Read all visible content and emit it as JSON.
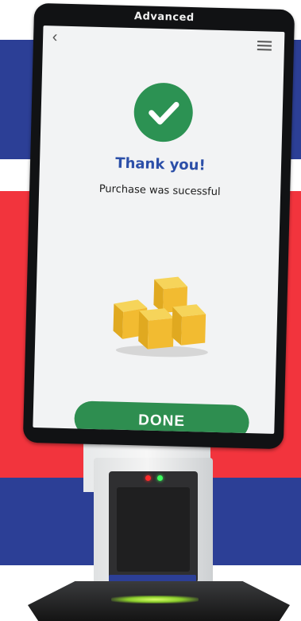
{
  "kiosk": {
    "brand": "Advanced",
    "screen": {
      "back_icon": "chevron-left-icon",
      "menu_icon": "hamburger-menu-icon",
      "status_icon": "checkmark-icon",
      "title": "Thank you!",
      "message": "Purchase was sucessful",
      "illustration_icon": "boxes-icon",
      "done_label": "DONE"
    },
    "indicators": [
      "red-led",
      "green-led"
    ]
  },
  "colors": {
    "accent_green": "#2e8e50",
    "title_blue": "#2c4fa8",
    "bg_blue": "#2c3f96",
    "bg_red": "#f2343d"
  }
}
